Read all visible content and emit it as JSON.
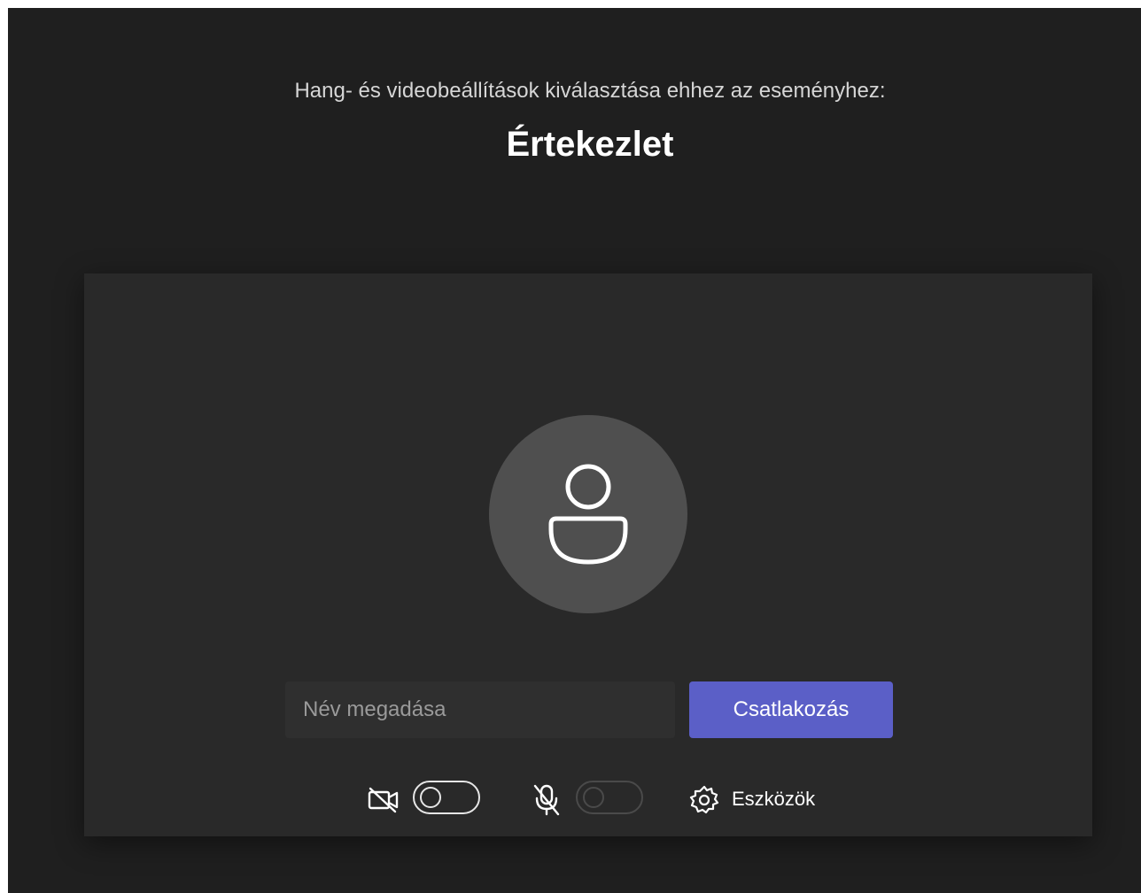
{
  "header": {
    "subtitle": "Hang- és videobeállítások kiválasztása ehhez az eseményhez:",
    "title": "Értekezlet"
  },
  "join": {
    "name_placeholder": "Név megadása",
    "name_value": "",
    "join_label": "Csatlakozás"
  },
  "controls": {
    "camera_icon": "camera-off-icon",
    "camera_toggle_on": false,
    "mic_icon": "mic-off-icon",
    "mic_toggle_on": false,
    "mic_toggle_disabled": true,
    "devices_icon": "gear-icon",
    "devices_label": "Eszközök"
  },
  "colors": {
    "background": "#1f1f1f",
    "panel": "#292929",
    "avatar": "#4f4f4f",
    "accent": "#5b5fc7"
  }
}
